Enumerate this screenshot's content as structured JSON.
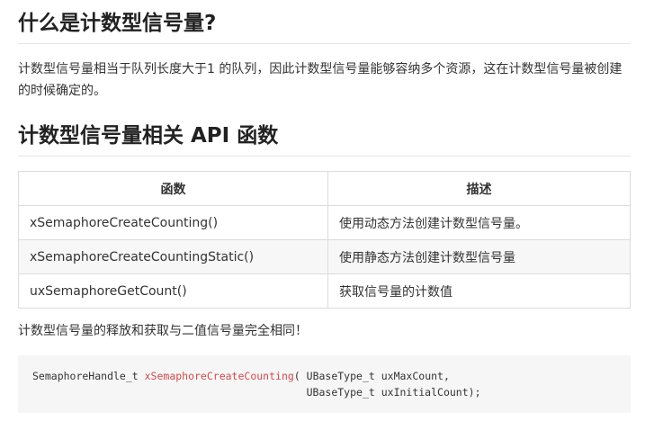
{
  "section1": {
    "title": "什么是计数型信号量?",
    "paragraph": "计数型信号量相当于队列长度大于1 的队列，因此计数型信号量能够容纳多个资源，这在计数型信号量被创建的时候确定的。"
  },
  "section2": {
    "title": "计数型信号量相关 API 函数",
    "table": {
      "headers": [
        "函数",
        "描述"
      ],
      "rows": [
        [
          "xSemaphoreCreateCounting()",
          "使用动态方法创建计数型信号量。"
        ],
        [
          "xSemaphoreCreateCountingStatic()",
          "使用静态方法创建计数型信号量"
        ],
        [
          "uxSemaphoreGetCount()",
          "获取信号量的计数值"
        ]
      ]
    },
    "note": "计数型信号量的释放和获取与二值信号量完全相同！",
    "code": {
      "prefix": "SemaphoreHandle_t ",
      "function": "xSemaphoreCreateCounting",
      "line1_rest": "( UBaseType_t uxMaxCount,",
      "line2": "                                            UBaseType_t uxInitialCount);"
    }
  },
  "colors": {
    "function_name": "#d04a4a",
    "code_background": "#f6f6f6",
    "table_alt_row": "#f7f7f7"
  }
}
